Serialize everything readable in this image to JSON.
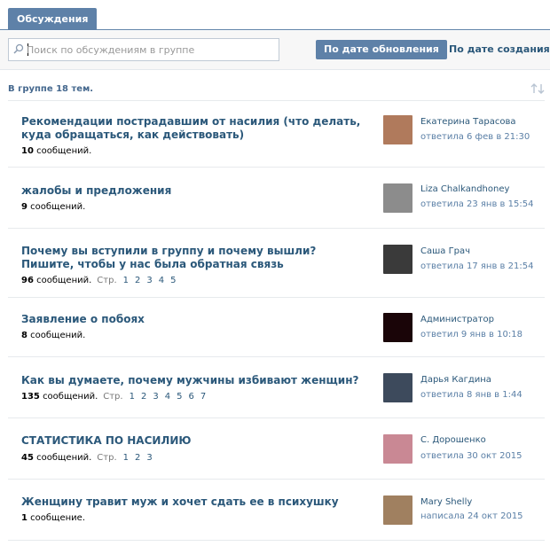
{
  "tab": {
    "label": "Обсуждения"
  },
  "search": {
    "placeholder": "Поиск по обсуждениям в группе"
  },
  "sort": {
    "by_update": "По дате обновления",
    "by_creation": "По дате создания"
  },
  "summary": "В группе 18 тем.",
  "colors": {
    "accent": "#5e81a8",
    "link": "#2b587a",
    "muted": "#5a7fa6"
  },
  "topics": [
    {
      "title": "Рекомендации пострадавшим от насилия (что делать, куда обращаться, как действовать)",
      "count": "10",
      "count_word": "сообщений.",
      "pages_label": "",
      "pages": [],
      "author": "Екатерина Тарасова",
      "reply": "ответила 6 фев в 21:30",
      "avatar_color": "#b07a5c"
    },
    {
      "title": "жалобы и предложения",
      "count": "9",
      "count_word": "сообщений.",
      "pages_label": "",
      "pages": [],
      "author": "Liza Chalkandhoney",
      "reply": "ответила 23 янв в 15:54",
      "avatar_color": "#8c8c8c"
    },
    {
      "title": "Почему вы вступили в группу и почему вышли? Пишите, чтобы у нас была обратная связь",
      "count": "96",
      "count_word": "сообщений.",
      "pages_label": "Стр.",
      "pages": [
        "1",
        "2",
        "3",
        "4",
        "5"
      ],
      "author": "Саша Грач",
      "reply": "ответила 17 янв в 21:54",
      "avatar_color": "#3a3a3a"
    },
    {
      "title": "Заявление о побоях",
      "count": "8",
      "count_word": "сообщений.",
      "pages_label": "",
      "pages": [],
      "author": "Администратор",
      "reply": "ответил 9 янв в 10:18",
      "avatar_color": "#1a0508"
    },
    {
      "title": "Как вы думаете, почему мужчины избивают женщин?",
      "count": "135",
      "count_word": "сообщений.",
      "pages_label": "Стр.",
      "pages": [
        "1",
        "2",
        "3",
        "4",
        "5",
        "6",
        "7"
      ],
      "author": "Дарья Кагдина",
      "reply": "ответила 8 янв в 1:44",
      "avatar_color": "#3d4a5c"
    },
    {
      "title": "СТАТИСТИКА ПО НАСИЛИЮ",
      "count": "45",
      "count_word": "сообщений.",
      "pages_label": "Стр.",
      "pages": [
        "1",
        "2",
        "3"
      ],
      "author": "С. Дорошенко",
      "reply": "ответила 30 окт 2015",
      "avatar_color": "#c98894"
    },
    {
      "title": "Женщину травит муж и хочет сдать ее в психушку",
      "count": "1",
      "count_word": "сообщение.",
      "pages_label": "",
      "pages": [],
      "author": "Mary Shelly",
      "reply": "написала 24 окт 2015",
      "avatar_color": "#a08060"
    }
  ]
}
